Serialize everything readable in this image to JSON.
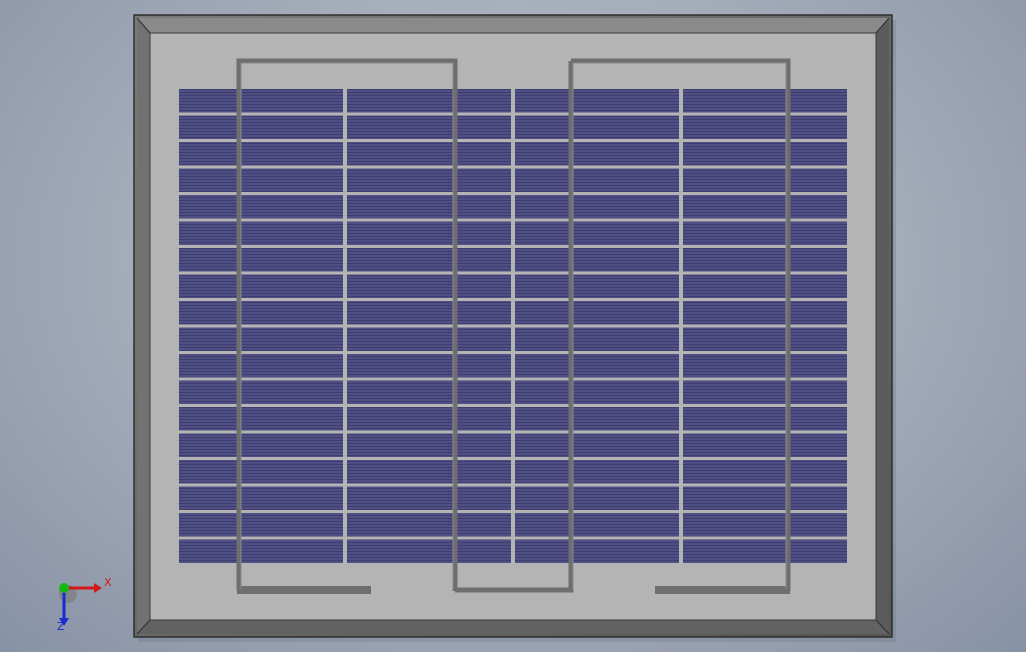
{
  "view": {
    "type": "cad-viewport",
    "orientation_axes": {
      "x_label": "X",
      "z_label": "Z",
      "x_color": "#d21818",
      "y_color": "#14b814",
      "z_color": "#1a2bd0"
    }
  },
  "model": {
    "name": "solar panel",
    "frame_color": "#6a6a6a",
    "backplate_color": "#b4b4b4",
    "cell_color": "#4f4f86",
    "cell_line_color": "#3e3e6e",
    "rail_color": "#6e6e6e",
    "cell_grid": {
      "columns": 4,
      "rows": 18
    },
    "rails": [
      {
        "name": "left-rail"
      },
      {
        "name": "right-rail"
      }
    ]
  }
}
